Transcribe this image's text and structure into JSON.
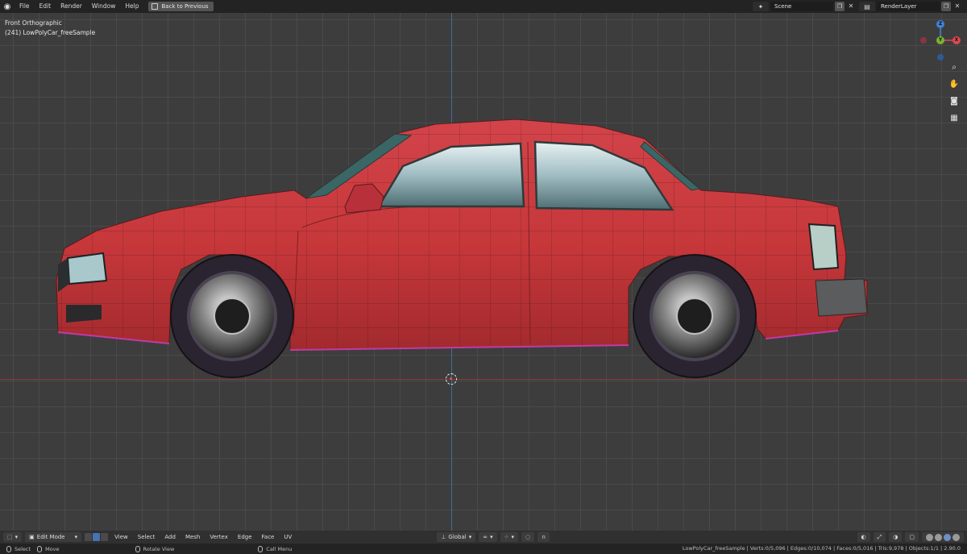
{
  "topbar": {
    "menus": [
      "File",
      "Edit",
      "Render",
      "Window",
      "Help"
    ],
    "back_button": "Back to Previous",
    "scene": "Scene",
    "render_layer": "RenderLayer"
  },
  "viewport": {
    "view_name": "Front Orthographic",
    "object_label": "(241) LowPolyCar_freeSample"
  },
  "gizmo": {
    "x": "X",
    "y": "Y",
    "z": "Z"
  },
  "header": {
    "mode": "Edit Mode",
    "menus": [
      "View",
      "Select",
      "Add",
      "Mesh",
      "Vertex",
      "Edge",
      "Face",
      "UV"
    ],
    "transform_orientation": "Global"
  },
  "statusbar": {
    "select": "Select",
    "move": "Move",
    "rotate": "Rotate View",
    "call_menu": "Call Menu",
    "stats": "LowPolyCar_freeSample | Verts:0/5,096 | Edges:0/10,074 | Faces:0/5,016 | Tris:9,978 | Objects:1/1 | 2.90.0"
  },
  "colors": {
    "car_body": "#c6373a",
    "x_axis": "#e0474e",
    "y_axis": "#7bb32e",
    "z_axis": "#3e82d8"
  }
}
